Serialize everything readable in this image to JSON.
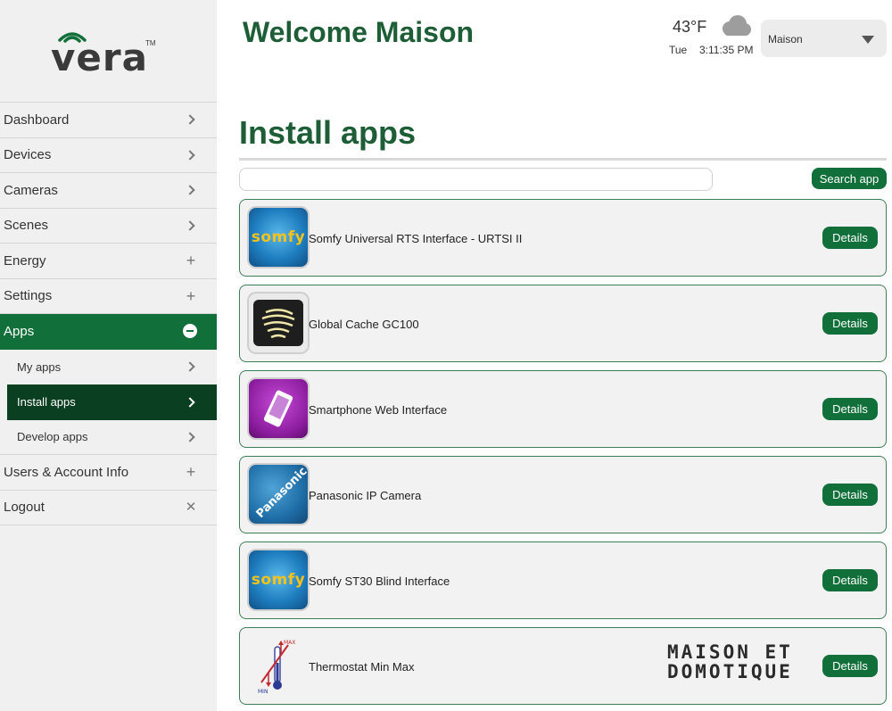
{
  "brand": {
    "logo_text": "vera",
    "trademark": "TM"
  },
  "header": {
    "welcome": "Welcome Maison",
    "weather": {
      "temperature": "43°F",
      "day": "Tue",
      "time": "3:11:35 PM",
      "icon": "cloud-icon"
    },
    "house_select": {
      "value": "Maison"
    }
  },
  "sidebar": {
    "items": [
      {
        "label": "Dashboard",
        "icon": "chevron-right-icon"
      },
      {
        "label": "Devices",
        "icon": "chevron-right-icon"
      },
      {
        "label": "Cameras",
        "icon": "chevron-right-icon"
      },
      {
        "label": "Scenes",
        "icon": "chevron-right-icon"
      },
      {
        "label": "Energy",
        "icon": "plus-icon"
      },
      {
        "label": "Settings",
        "icon": "plus-icon"
      },
      {
        "label": "Apps",
        "icon": "minus-circle-icon",
        "active": true,
        "sub_items": [
          {
            "label": "My apps",
            "icon": "chevron-right-icon"
          },
          {
            "label": "Install apps",
            "icon": "chevron-right-icon",
            "active": true
          },
          {
            "label": "Develop apps",
            "icon": "chevron-right-icon"
          }
        ]
      },
      {
        "label": "Users & Account Info",
        "icon": "plus-icon"
      },
      {
        "label": "Logout",
        "icon": "close-icon"
      }
    ]
  },
  "main": {
    "title": "Install apps",
    "search": {
      "value": "",
      "placeholder": "",
      "button_label": "Search app"
    },
    "apps": [
      {
        "name": "Somfy Universal RTS Interface - URTSI II",
        "icon": "somfy-logo-icon",
        "icon_text": "somfy",
        "button_label": "Details"
      },
      {
        "name": "Global Cache GC100",
        "icon": "global-cache-icon",
        "button_label": "Details"
      },
      {
        "name": "Smartphone Web Interface",
        "icon": "smartphone-icon",
        "button_label": "Details"
      },
      {
        "name": "Panasonic IP Camera",
        "icon": "panasonic-logo-icon",
        "icon_text": "Panasonic",
        "button_label": "Details"
      },
      {
        "name": "Somfy ST30 Blind Interface",
        "icon": "somfy-logo-icon",
        "icon_text": "somfy",
        "button_label": "Details"
      },
      {
        "name": "Thermostat Min Max",
        "icon": "thermometer-icon",
        "icon_labels": {
          "max": "MAX",
          "min": "MIN"
        },
        "button_label": "Details"
      }
    ]
  },
  "watermark": {
    "line1": "MAISON ET",
    "line2": "DOMOTIQUE"
  },
  "colors": {
    "primary_green": "#116f3a",
    "dark_green": "#0b3f21",
    "title_green": "#1d5e37",
    "somfy_yellow": "#f4c21b"
  }
}
